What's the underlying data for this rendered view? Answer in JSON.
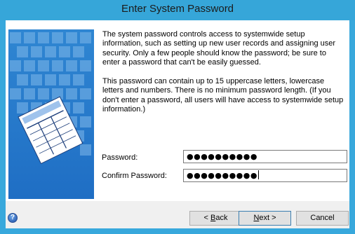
{
  "window": {
    "title": "Enter System Password"
  },
  "content": {
    "intro": "The system password controls access to systemwide setup information, such as setting up new user records and assigning user security. Only a few people should know the password; be sure to enter a password that can't be easily guessed.",
    "detail": "This password can contain up to 15 uppercase letters, lowercase letters and numbers. There is no minimum password length. (If you don't enter a password, all users will have access to systemwide setup information.)"
  },
  "fields": {
    "password_label": "Password:",
    "password_value": "●●●●●●●●●●",
    "confirm_label": "Confirm Password:",
    "confirm_value": "●●●●●●●●●●"
  },
  "buttons": {
    "back_prefix": "< ",
    "back_mnemonic": "B",
    "back_rest": "ack",
    "next_mnemonic": "N",
    "next_rest": "ext >",
    "cancel": "Cancel"
  },
  "icons": {
    "help": "?"
  },
  "colors": {
    "title_bar": "#36a6d9",
    "side_panel": "#2f86d2",
    "default_button_border": "#3c7fb1"
  }
}
